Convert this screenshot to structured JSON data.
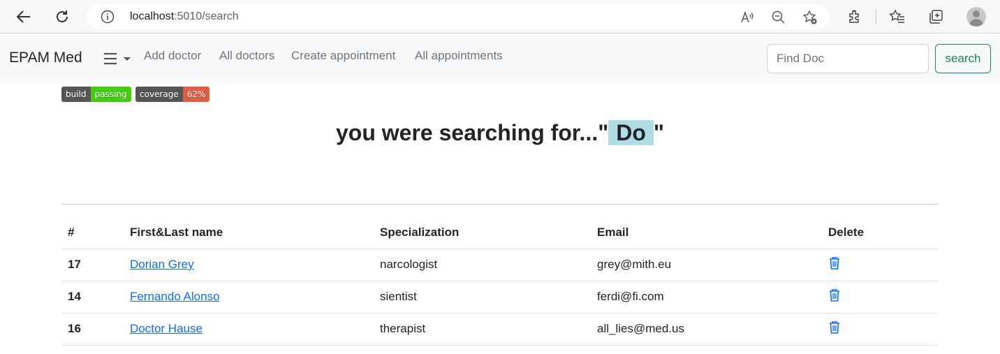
{
  "browser": {
    "url_host": "localhost",
    "url_path": ":5010/search"
  },
  "navbar": {
    "brand": "EPAM Med",
    "menu_icon": "hamburger-icon",
    "links": [
      "Add doctor",
      "All doctors",
      "Create appointment",
      "All appointments"
    ],
    "search_placeholder": "Find Doc",
    "search_button": "search",
    "accent_color": "#198754"
  },
  "badges": [
    {
      "label": "build",
      "value": "passing",
      "color": "#44cc11"
    },
    {
      "label": "coverage",
      "value": "62%",
      "color": "#e05d44"
    }
  ],
  "heading": {
    "prefix": "you were searching for...\"",
    "query": " Do ",
    "suffix": "\""
  },
  "table": {
    "headers": [
      "#",
      "First&Last name",
      "Specialization",
      "Email",
      "Delete"
    ],
    "rows": [
      {
        "id": "17",
        "name": "Dorian Grey",
        "specialization": "narcologist",
        "email": "grey@mith.eu",
        "delete_icon": "trash-icon"
      },
      {
        "id": "14",
        "name": "Fernando Alonso",
        "specialization": "sientist",
        "email": "ferdi@fi.com",
        "delete_icon": "trash-icon"
      },
      {
        "id": "16",
        "name": "Doctor Hause",
        "specialization": "therapist",
        "email": "all_lies@med.us",
        "delete_icon": "trash-icon"
      }
    ]
  }
}
